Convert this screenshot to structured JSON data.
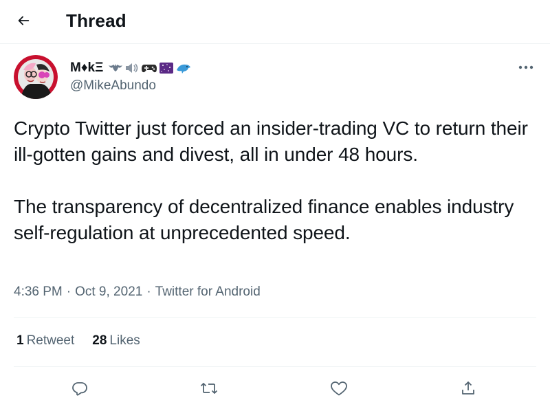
{
  "header": {
    "title": "Thread",
    "back_icon": "arrow-left-icon"
  },
  "tweet": {
    "author": {
      "display_name": "M♦kΞ",
      "name_emojis": [
        "bat-icon",
        "speaker-icon",
        "game-controller-icon",
        "night-sky-icon",
        "dolphin-icon"
      ],
      "handle": "@MikeAbundo",
      "avatar": "avatar-illustration"
    },
    "text": [
      "Crypto Twitter just forced an insider-trading VC to return their ill-gotten gains and divest, all in under 48 hours.",
      "The transparency of decentralized finance enables industry self-regulation at unprecedented speed."
    ],
    "time": "4:36 PM",
    "date": "Oct 9, 2021",
    "source": "Twitter for Android",
    "separator": "·",
    "stats": {
      "retweets_count": "1",
      "retweets_label": "Retweet",
      "likes_count": "28",
      "likes_label": "Likes"
    }
  },
  "colors": {
    "text": "#0f1419",
    "secondary": "#536471",
    "border": "#eff3f4"
  }
}
